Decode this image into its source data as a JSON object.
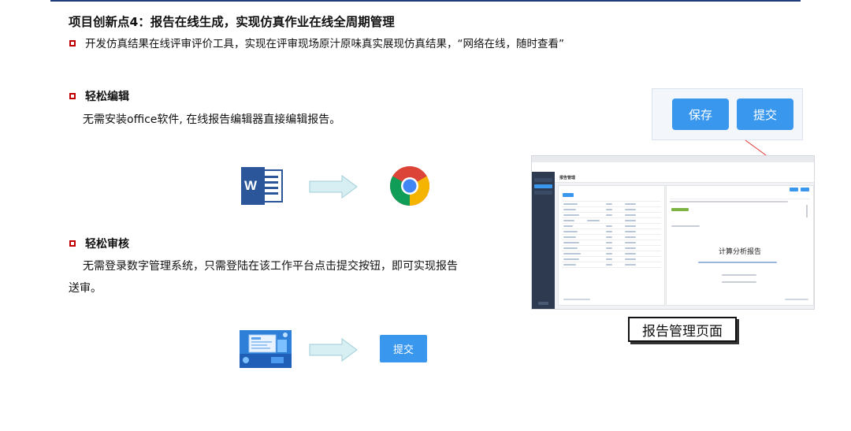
{
  "header": {
    "title": "项目创新点4：报告在线生成，实现仿真作业在线全周期管理",
    "intro": "开发仿真结果在线评审评价工具，实现在评审现场原汁原味真实展现仿真结果，“网络在线，随时查看”"
  },
  "sections": [
    {
      "title": "轻松编辑",
      "desc": "无需安装office软件, 在线报告编辑器直接编辑报告。"
    },
    {
      "title": "轻松审核",
      "desc_line1": "无需登录数字管理系统，只需登陆在该工作平台点击提交按钮，即可实现报告",
      "desc_line2": "送审。"
    }
  ],
  "icons": {
    "word_letter": "W"
  },
  "buttons": {
    "save": "保存",
    "submit": "提交",
    "submit_small": "提交"
  },
  "screenshot": {
    "page_title": "报告管理",
    "doc_title": "计算分析报告"
  },
  "caption": "报告管理页面",
  "colors": {
    "accent_blue": "#3a97ee",
    "bullet_red": "#c00000",
    "rule_navy": "#1f3e7a",
    "arrow_fill": "#d7eef2",
    "arrow_stroke": "#9fcfd9"
  }
}
